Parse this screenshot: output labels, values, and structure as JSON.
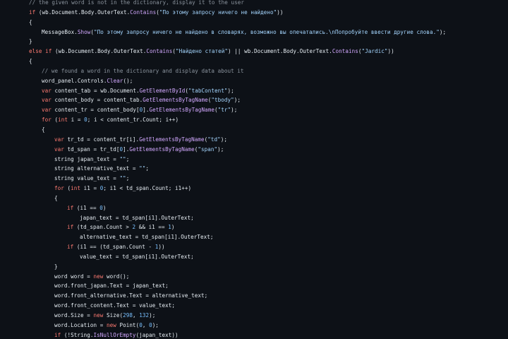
{
  "theme": {
    "background": "#0d1117",
    "plain": "#e6edf3",
    "keyword": "#ff7b72",
    "string": "#a5d6ff",
    "method": "#d2a8ff",
    "comment": "#8b949e",
    "number": "#79c0ff"
  },
  "code_lines": [
    {
      "indent": 0,
      "tokens": [
        {
          "t": "comment",
          "v": "// the given word is not in the dictionary, display it to the user"
        }
      ]
    },
    {
      "indent": 0,
      "tokens": [
        {
          "t": "keyword",
          "v": "if"
        },
        {
          "t": "plain",
          "v": " (wb.Document.Body.OuterText."
        },
        {
          "t": "method",
          "v": "Contains"
        },
        {
          "t": "plain",
          "v": "("
        },
        {
          "t": "string",
          "v": "\"По этому запросу ничего не найдено\""
        },
        {
          "t": "plain",
          "v": "))"
        }
      ]
    },
    {
      "indent": 0,
      "tokens": [
        {
          "t": "plain",
          "v": "{"
        }
      ]
    },
    {
      "indent": 1,
      "tokens": [
        {
          "t": "plain",
          "v": "MessageBox."
        },
        {
          "t": "method",
          "v": "Show"
        },
        {
          "t": "plain",
          "v": "("
        },
        {
          "t": "string",
          "v": "\"По этому запросу ничего не найдено в словарях, возможно вы опечатались.\\nПопробуйте ввести другие слова.\""
        },
        {
          "t": "plain",
          "v": ");"
        }
      ]
    },
    {
      "indent": 0,
      "tokens": [
        {
          "t": "plain",
          "v": "}"
        }
      ]
    },
    {
      "indent": 0,
      "tokens": [
        {
          "t": "keyword",
          "v": "else if"
        },
        {
          "t": "plain",
          "v": " (wb.Document.Body.OuterText."
        },
        {
          "t": "method",
          "v": "Contains"
        },
        {
          "t": "plain",
          "v": "("
        },
        {
          "t": "string",
          "v": "\"Найдено статей\""
        },
        {
          "t": "plain",
          "v": ") || wb.Document.Body.OuterText."
        },
        {
          "t": "method",
          "v": "Contains"
        },
        {
          "t": "plain",
          "v": "("
        },
        {
          "t": "string",
          "v": "\"Jardic\""
        },
        {
          "t": "plain",
          "v": "))"
        }
      ]
    },
    {
      "indent": 0,
      "tokens": [
        {
          "t": "plain",
          "v": "{"
        }
      ]
    },
    {
      "indent": 1,
      "tokens": [
        {
          "t": "comment",
          "v": "// we found a word in the dictionary and display data about it"
        }
      ]
    },
    {
      "indent": 1,
      "tokens": [
        {
          "t": "plain",
          "v": "word_panel.Controls."
        },
        {
          "t": "method",
          "v": "Clear"
        },
        {
          "t": "plain",
          "v": "();"
        }
      ]
    },
    {
      "indent": 1,
      "tokens": [
        {
          "t": "keyword",
          "v": "var"
        },
        {
          "t": "plain",
          "v": " content_tab = wb.Document."
        },
        {
          "t": "method",
          "v": "GetElementById"
        },
        {
          "t": "plain",
          "v": "("
        },
        {
          "t": "string",
          "v": "\"tabContent\""
        },
        {
          "t": "plain",
          "v": ");"
        }
      ]
    },
    {
      "indent": 1,
      "tokens": [
        {
          "t": "keyword",
          "v": "var"
        },
        {
          "t": "plain",
          "v": " content_body = content_tab."
        },
        {
          "t": "method",
          "v": "GetElementsByTagName"
        },
        {
          "t": "plain",
          "v": "("
        },
        {
          "t": "string",
          "v": "\"tbody\""
        },
        {
          "t": "plain",
          "v": ");"
        }
      ]
    },
    {
      "indent": 1,
      "tokens": [
        {
          "t": "keyword",
          "v": "var"
        },
        {
          "t": "plain",
          "v": " content_tr = content_body["
        },
        {
          "t": "number",
          "v": "0"
        },
        {
          "t": "plain",
          "v": "]."
        },
        {
          "t": "method",
          "v": "GetElementsByTagName"
        },
        {
          "t": "plain",
          "v": "("
        },
        {
          "t": "string",
          "v": "\"tr\""
        },
        {
          "t": "plain",
          "v": ");"
        }
      ]
    },
    {
      "indent": 1,
      "tokens": [
        {
          "t": "keyword",
          "v": "for"
        },
        {
          "t": "plain",
          "v": " ("
        },
        {
          "t": "keyword",
          "v": "int"
        },
        {
          "t": "plain",
          "v": " i = "
        },
        {
          "t": "number",
          "v": "0"
        },
        {
          "t": "plain",
          "v": "; i < content_tr.Count; i++)"
        }
      ]
    },
    {
      "indent": 1,
      "tokens": [
        {
          "t": "plain",
          "v": "{"
        }
      ]
    },
    {
      "indent": 2,
      "tokens": [
        {
          "t": "keyword",
          "v": "var"
        },
        {
          "t": "plain",
          "v": " tr_td = content_tr[i]."
        },
        {
          "t": "method",
          "v": "GetElementsByTagName"
        },
        {
          "t": "plain",
          "v": "("
        },
        {
          "t": "string",
          "v": "\"td\""
        },
        {
          "t": "plain",
          "v": ");"
        }
      ]
    },
    {
      "indent": 2,
      "tokens": [
        {
          "t": "keyword",
          "v": "var"
        },
        {
          "t": "plain",
          "v": " td_span = tr_td["
        },
        {
          "t": "number",
          "v": "0"
        },
        {
          "t": "plain",
          "v": "]."
        },
        {
          "t": "method",
          "v": "GetElementsByTagName"
        },
        {
          "t": "plain",
          "v": "("
        },
        {
          "t": "string",
          "v": "\"span\""
        },
        {
          "t": "plain",
          "v": ");"
        }
      ]
    },
    {
      "indent": 2,
      "tokens": [
        {
          "t": "plain",
          "v": "string japan_text = "
        },
        {
          "t": "string",
          "v": "\"\""
        },
        {
          "t": "plain",
          "v": ";"
        }
      ]
    },
    {
      "indent": 2,
      "tokens": [
        {
          "t": "plain",
          "v": "string alternative_text = "
        },
        {
          "t": "string",
          "v": "\"\""
        },
        {
          "t": "plain",
          "v": ";"
        }
      ]
    },
    {
      "indent": 2,
      "tokens": [
        {
          "t": "plain",
          "v": "string value_text = "
        },
        {
          "t": "string",
          "v": "\"\""
        },
        {
          "t": "plain",
          "v": ";"
        }
      ]
    },
    {
      "indent": 2,
      "tokens": [
        {
          "t": "keyword",
          "v": "for"
        },
        {
          "t": "plain",
          "v": " ("
        },
        {
          "t": "keyword",
          "v": "int"
        },
        {
          "t": "plain",
          "v": " i1 = "
        },
        {
          "t": "number",
          "v": "0"
        },
        {
          "t": "plain",
          "v": "; i1 < td_span.Count; i1++)"
        }
      ]
    },
    {
      "indent": 2,
      "tokens": [
        {
          "t": "plain",
          "v": "{"
        }
      ]
    },
    {
      "indent": 3,
      "tokens": [
        {
          "t": "keyword",
          "v": "if"
        },
        {
          "t": "plain",
          "v": " (i1 == "
        },
        {
          "t": "number",
          "v": "0"
        },
        {
          "t": "plain",
          "v": ")"
        }
      ]
    },
    {
      "indent": 4,
      "tokens": [
        {
          "t": "plain",
          "v": "japan_text = td_span[i1].OuterText;"
        }
      ]
    },
    {
      "indent": 3,
      "tokens": [
        {
          "t": "keyword",
          "v": "if"
        },
        {
          "t": "plain",
          "v": " (td_span.Count > "
        },
        {
          "t": "number",
          "v": "2"
        },
        {
          "t": "plain",
          "v": " && i1 == "
        },
        {
          "t": "number",
          "v": "1"
        },
        {
          "t": "plain",
          "v": ")"
        }
      ]
    },
    {
      "indent": 4,
      "tokens": [
        {
          "t": "plain",
          "v": "alternative_text = td_span[i1].OuterText;"
        }
      ]
    },
    {
      "indent": 3,
      "tokens": [
        {
          "t": "keyword",
          "v": "if"
        },
        {
          "t": "plain",
          "v": " (i1 == (td_span.Count - "
        },
        {
          "t": "number",
          "v": "1"
        },
        {
          "t": "plain",
          "v": "))"
        }
      ]
    },
    {
      "indent": 4,
      "tokens": [
        {
          "t": "plain",
          "v": "value_text = td_span[i1].OuterText;"
        }
      ]
    },
    {
      "indent": 2,
      "tokens": [
        {
          "t": "plain",
          "v": "}"
        }
      ]
    },
    {
      "indent": 2,
      "tokens": [
        {
          "t": "plain",
          "v": "word word = "
        },
        {
          "t": "keyword",
          "v": "new"
        },
        {
          "t": "plain",
          "v": " word();"
        }
      ]
    },
    {
      "indent": 2,
      "tokens": [
        {
          "t": "plain",
          "v": "word.front_japan.Text = japan_text;"
        }
      ]
    },
    {
      "indent": 2,
      "tokens": [
        {
          "t": "plain",
          "v": "word.front_alternative.Text = alternative_text;"
        }
      ]
    },
    {
      "indent": 2,
      "tokens": [
        {
          "t": "plain",
          "v": "word.front_content.Text = value_text;"
        }
      ]
    },
    {
      "indent": 2,
      "tokens": [
        {
          "t": "plain",
          "v": "word.Size = "
        },
        {
          "t": "keyword",
          "v": "new"
        },
        {
          "t": "plain",
          "v": " Size("
        },
        {
          "t": "number",
          "v": "298"
        },
        {
          "t": "plain",
          "v": ", "
        },
        {
          "t": "number",
          "v": "132"
        },
        {
          "t": "plain",
          "v": ");"
        }
      ]
    },
    {
      "indent": 2,
      "tokens": [
        {
          "t": "plain",
          "v": "word.Location = "
        },
        {
          "t": "keyword",
          "v": "new"
        },
        {
          "t": "plain",
          "v": " Point("
        },
        {
          "t": "number",
          "v": "0"
        },
        {
          "t": "plain",
          "v": ", "
        },
        {
          "t": "number",
          "v": "0"
        },
        {
          "t": "plain",
          "v": ");"
        }
      ]
    },
    {
      "indent": 2,
      "tokens": [
        {
          "t": "keyword",
          "v": "if"
        },
        {
          "t": "plain",
          "v": " (!String."
        },
        {
          "t": "method",
          "v": "IsNullOrEmpty"
        },
        {
          "t": "plain",
          "v": "(japan_text))"
        }
      ]
    }
  ]
}
